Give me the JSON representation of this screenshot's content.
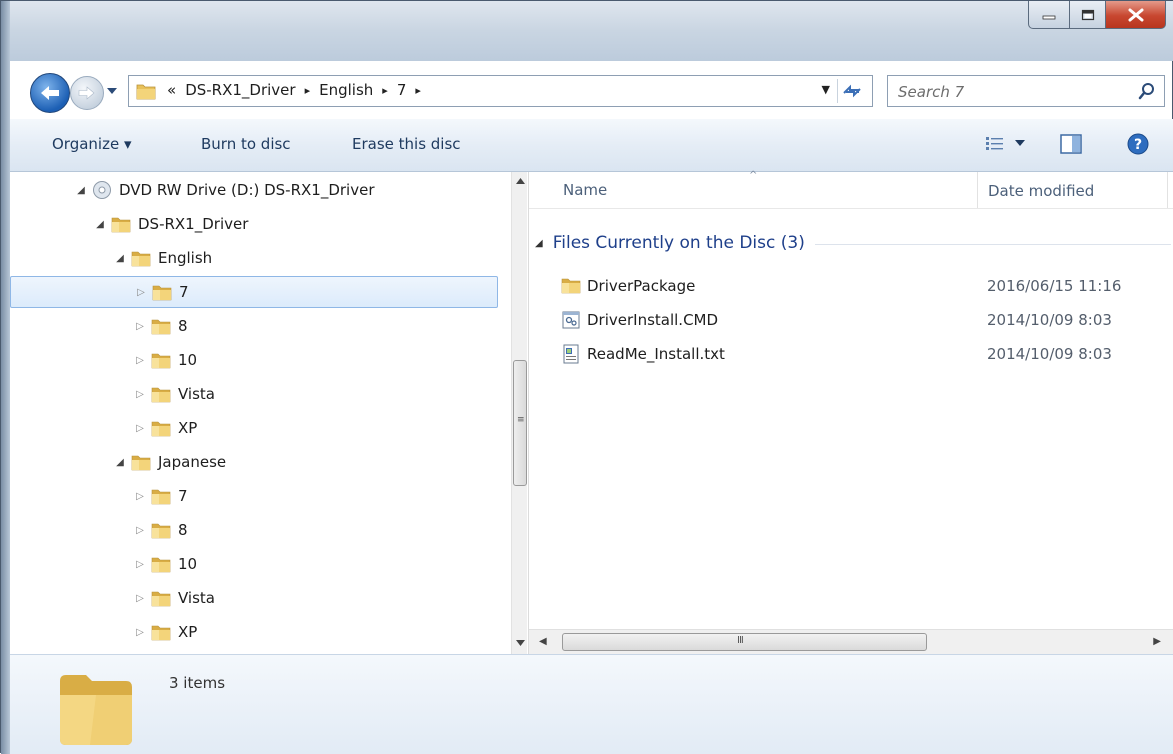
{
  "window": {
    "caption_buttons": [
      "minimize-icon",
      "maximize-icon",
      "close-icon"
    ]
  },
  "address_bar": {
    "overflow": "«",
    "crumbs": [
      "DS-RX1_Driver",
      "English",
      "7"
    ],
    "separator": "▸"
  },
  "search": {
    "placeholder": "Search 7"
  },
  "toolbar": {
    "organize_label": "Organize ▾",
    "burn_label": "Burn to disc",
    "erase_label": "Erase this disc"
  },
  "nav_tree": {
    "items": [
      {
        "label": "DVD RW Drive (D:) DS-RX1_Driver",
        "depth": 0,
        "expanded": true,
        "icon": "disc-drive-icon",
        "selected": false
      },
      {
        "label": "DS-RX1_Driver",
        "depth": 1,
        "expanded": true,
        "icon": "folder-icon",
        "selected": false
      },
      {
        "label": "English",
        "depth": 2,
        "expanded": true,
        "icon": "folder-icon",
        "selected": false
      },
      {
        "label": "7",
        "depth": 3,
        "expanded": false,
        "icon": "folder-icon",
        "selected": true
      },
      {
        "label": "8",
        "depth": 3,
        "expanded": false,
        "icon": "folder-icon",
        "selected": false
      },
      {
        "label": "10",
        "depth": 3,
        "expanded": false,
        "icon": "folder-icon",
        "selected": false
      },
      {
        "label": "Vista",
        "depth": 3,
        "expanded": false,
        "icon": "folder-icon",
        "selected": false
      },
      {
        "label": "XP",
        "depth": 3,
        "expanded": false,
        "icon": "folder-icon",
        "selected": false
      },
      {
        "label": "Japanese",
        "depth": 2,
        "expanded": true,
        "icon": "folder-icon",
        "selected": false
      },
      {
        "label": "7",
        "depth": 3,
        "expanded": false,
        "icon": "folder-icon",
        "selected": false
      },
      {
        "label": "8",
        "depth": 3,
        "expanded": false,
        "icon": "folder-icon",
        "selected": false
      },
      {
        "label": "10",
        "depth": 3,
        "expanded": false,
        "icon": "folder-icon",
        "selected": false
      },
      {
        "label": "Vista",
        "depth": 3,
        "expanded": false,
        "icon": "folder-icon",
        "selected": false
      },
      {
        "label": "XP",
        "depth": 3,
        "expanded": false,
        "icon": "folder-icon",
        "selected": false
      }
    ]
  },
  "content": {
    "columns": {
      "name": "Name",
      "date": "Date modified"
    },
    "group_title": "Files Currently on the Disc (3)",
    "files": [
      {
        "name": "DriverPackage",
        "date": "2016/06/15 11:16",
        "icon": "folder-icon"
      },
      {
        "name": "DriverInstall.CMD",
        "date": "2014/10/09 8:03",
        "icon": "cmd-file-icon"
      },
      {
        "name": "ReadMe_Install.txt",
        "date": "2014/10/09 8:03",
        "icon": "text-file-icon"
      }
    ]
  },
  "details": {
    "count": "3 items"
  },
  "colors": {
    "group_title": "#1e3f8a",
    "selection_border": "#8fb7e6",
    "folder": "#e8c15a"
  }
}
